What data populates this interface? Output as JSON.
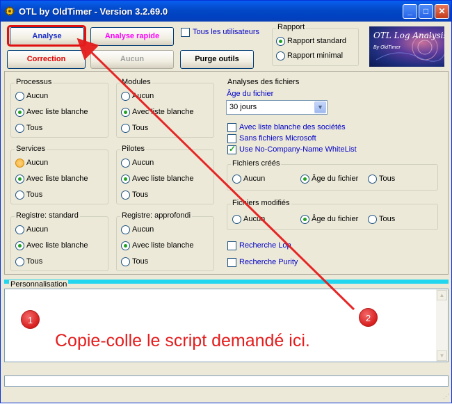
{
  "window": {
    "title": "OTL by OldTimer - Version 3.2.69.0",
    "title_buttons": {
      "minimize": "_",
      "maximize": "□",
      "close": "✕"
    }
  },
  "toolbar": {
    "analyse": "Analyse",
    "analyse_rapide": "Analyse rapide",
    "correction": "Correction",
    "aucun": "Aucun",
    "purge_outils": "Purge outils",
    "tous_utilisateurs": "Tous les utilisateurs"
  },
  "rapport": {
    "title": "Rapport",
    "standard": "Rapport standard",
    "minimal": "Rapport minimal"
  },
  "logo": {
    "title": "OTL Log Analysis",
    "subtitle": "By OldTimer"
  },
  "sections": {
    "processus": {
      "title": "Processus",
      "aucun": "Aucun",
      "avec": "Avec liste blanche",
      "tous": "Tous"
    },
    "modules": {
      "title": "Modules",
      "aucun": "Aucun",
      "avec": "Avec liste blanche",
      "tous": "Tous"
    },
    "services": {
      "title": "Services",
      "aucun": "Aucun",
      "avec": "Avec liste blanche",
      "tous": "Tous"
    },
    "pilotes": {
      "title": "Pilotes",
      "aucun": "Aucun",
      "avec": "Avec liste blanche",
      "tous": "Tous"
    },
    "registre_standard": {
      "title": "Registre: standard",
      "aucun": "Aucun",
      "avec": "Avec liste blanche",
      "tous": "Tous"
    },
    "registre_approfondi": {
      "title": "Registre: approfondi",
      "aucun": "Aucun",
      "avec": "Avec liste blanche",
      "tous": "Tous"
    }
  },
  "analyses": {
    "title": "Analyses des fichiers",
    "age_label": "Âge du fichier",
    "age_value": "30 jours",
    "liste_societes": "Avec liste blanche des sociétés",
    "sans_microsoft": "Sans fichiers Microsoft",
    "no_company": "Use No-Company-Name WhiteList",
    "fichiers_crees": {
      "title": "Fichiers créés",
      "aucun": "Aucun",
      "age": "Âge du fichier",
      "tous": "Tous"
    },
    "fichiers_modifies": {
      "title": "Fichiers modifiés",
      "aucun": "Aucun",
      "age": "Âge du fichier",
      "tous": "Tous"
    },
    "recherche_lop": "Recherche Lop",
    "recherche_purity": "Recherche Purity"
  },
  "personnalisation": {
    "label": "Personnalisation"
  },
  "annotations": {
    "marker1": "1",
    "marker2": "2",
    "instruction": "Copie-colle le script demandé ici."
  },
  "colors": {
    "annotation_red": "#e51c1c",
    "title_blue": "#0248c6",
    "perso_band": "#22d6ef"
  }
}
